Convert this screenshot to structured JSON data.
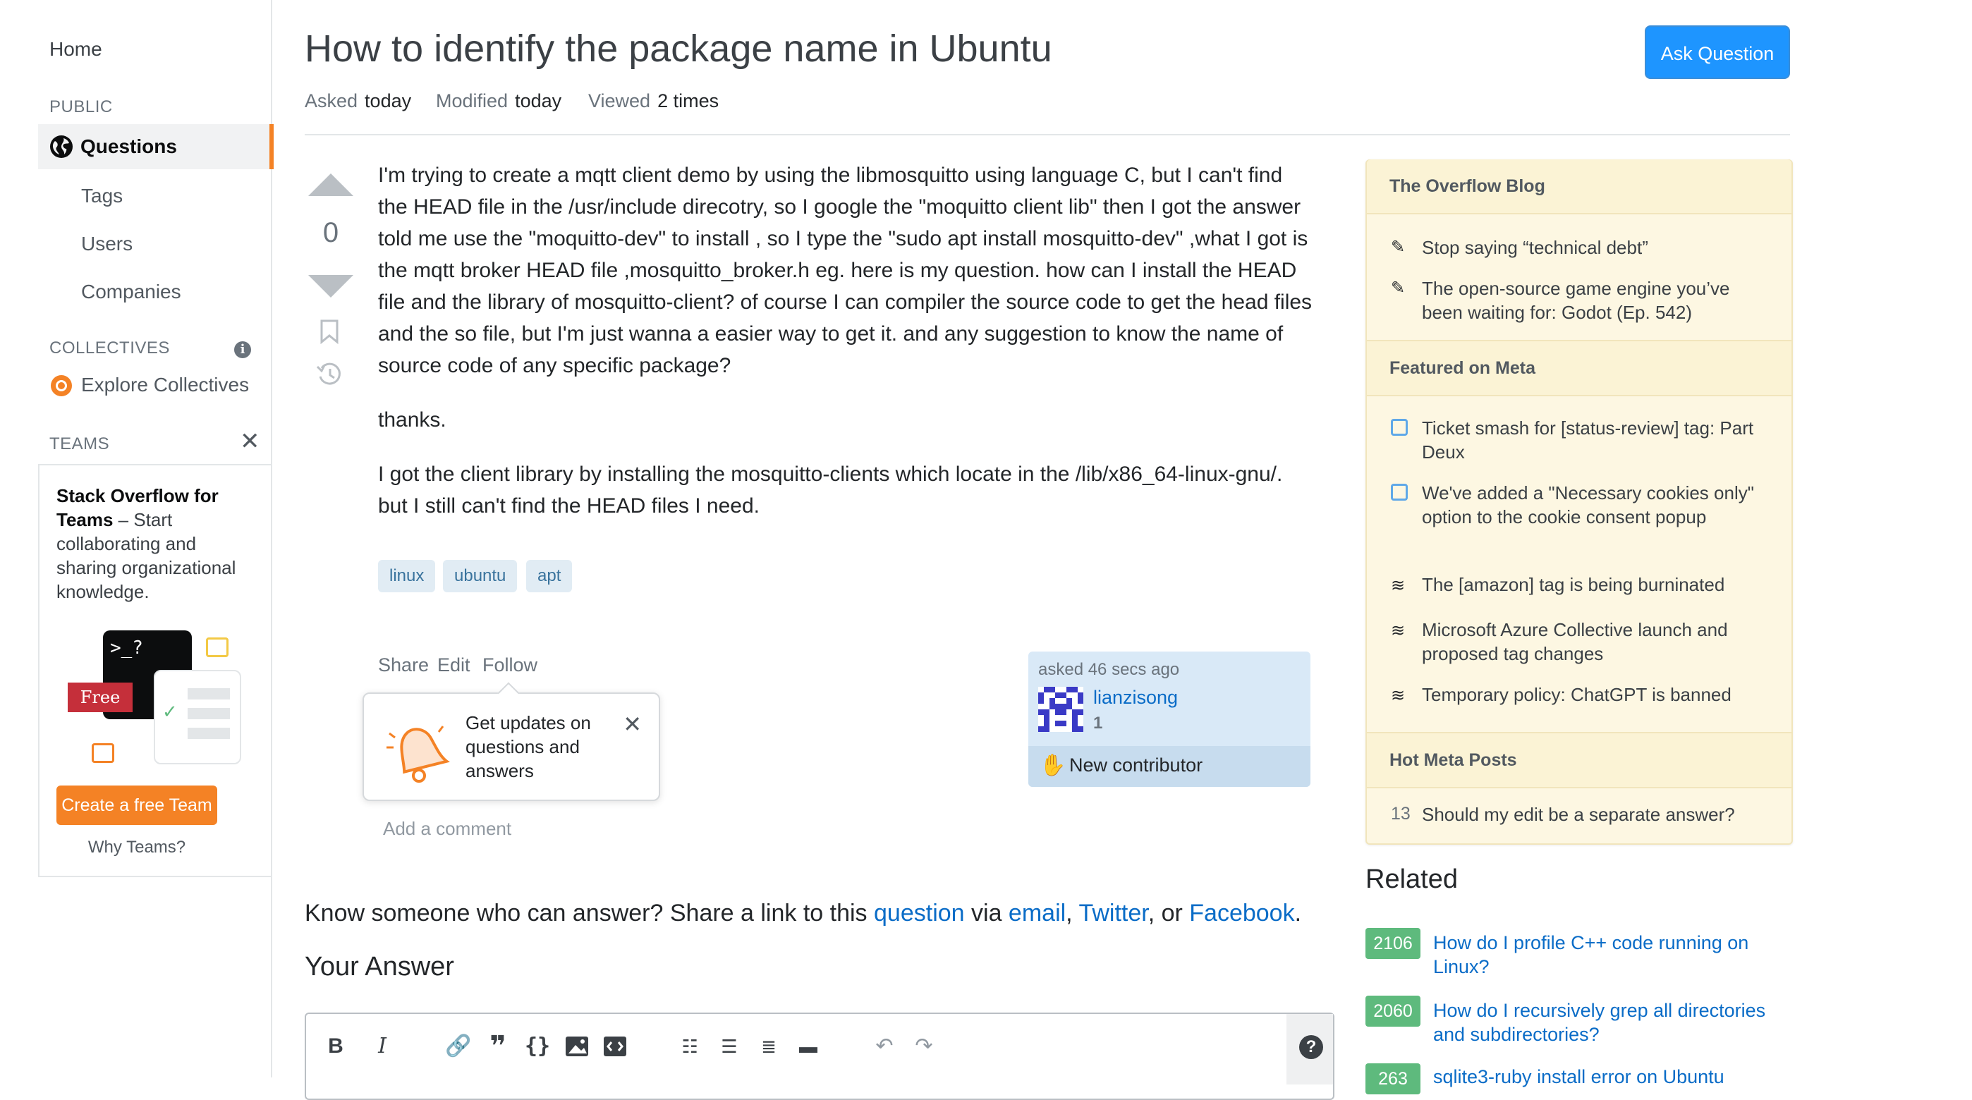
{
  "sidebar": {
    "home": "Home",
    "public_heading": "PUBLIC",
    "questions": "Questions",
    "tags": "Tags",
    "users": "Users",
    "companies": "Companies",
    "collectives_heading": "COLLECTIVES",
    "explore_collectives": "Explore Collectives",
    "teams_heading": "TEAMS",
    "teams_card": {
      "title_bold": "Stack Overflow for Teams",
      "title_rest": " – Start collaborating and sharing organizational knowledge.",
      "free_badge": "Free",
      "prompt_glyph": ">_?",
      "create_button": "Create a free Team",
      "why_link": "Why Teams?"
    }
  },
  "question": {
    "title": "How to identify the package name in Ubuntu",
    "ask_button": "Ask Question",
    "asked_label": "Asked",
    "asked_value": "today",
    "modified_label": "Modified",
    "modified_value": "today",
    "viewed_label": "Viewed",
    "viewed_value": "2 times",
    "vote_count": "0",
    "body": [
      "I'm trying to create a mqtt client demo by using the libmosquitto using language C, but I can't find the HEAD file in the /usr/include direcotry, so I google the \"moquitto client lib\" then I got the answer told me use the \"moquitto-dev\" to install , so I type the \"sudo apt install mosquitto-dev\" ,what I got is the mqtt broker HEAD file ,mosquitto_broker.h eg. here is my question. how can I install the HEAD file and the library of mosquitto-client? of course I can compiler the source code to get the head files and the so file, but I'm just wanna a easier way to get it. and any suggestion to know the name of source code of any specific package?",
      "thanks.",
      "I got the client library by installing the mosquitto-clients which locate in the /lib/x86_64-linux-gnu/. but I still can't find the HEAD files I need."
    ],
    "tags": [
      "linux",
      "ubuntu",
      "apt"
    ],
    "menu": {
      "share": "Share",
      "edit": "Edit",
      "follow": "Follow"
    },
    "popover_text": "Get updates on questions and answers",
    "add_comment": "Add a comment",
    "user_card": {
      "asked_time": "asked 46 secs ago",
      "username": "lianzisong",
      "reputation": "1",
      "new_contributor": "New contributor"
    }
  },
  "share_line": {
    "prefix": "Know someone who can answer? Share a link to this ",
    "question_link": "question",
    "via": " via ",
    "email": "email",
    "comma1": ", ",
    "twitter": "Twitter",
    "or": ", or ",
    "facebook": "Facebook",
    "end": "."
  },
  "your_answer": "Your Answer",
  "editor_toolbar": [
    "bold-icon",
    "italic-icon",
    "link-icon",
    "quote-icon",
    "code-icon",
    "image-icon",
    "snippet-icon",
    "ordered-list-icon",
    "unordered-list-icon",
    "heading-icon",
    "horizontal-rule-icon",
    "undo-icon",
    "redo-icon",
    "help-icon"
  ],
  "right_sidebar": {
    "blog_heading": "The Overflow Blog",
    "blog_items": [
      "Stop saying “technical debt”",
      "The open-source game engine you’ve been waiting for: Godot (Ep. 542)"
    ],
    "meta_heading": "Featured on Meta",
    "meta_items": [
      "Ticket smash for [status-review] tag: Part Deux",
      "We've added a \"Necessary cookies only\" option to the cookie consent popup",
      "The [amazon] tag is being burninated",
      "Microsoft Azure Collective launch and proposed tag changes",
      "Temporary policy: ChatGPT is banned"
    ],
    "hot_heading": "Hot Meta Posts",
    "hot_items": [
      {
        "count": "13",
        "title": "Should my edit be a separate answer?"
      }
    ],
    "related_heading": "Related",
    "related": [
      {
        "score": "2106",
        "title": "How do I profile C++ code running on Linux?"
      },
      {
        "score": "2060",
        "title": "How do I recursively grep all directories and subdirectories?"
      },
      {
        "score": "263",
        "title": "sqlite3-ruby install error on Ubuntu"
      }
    ]
  },
  "colors": {
    "accent": "#f48225",
    "brand_blue": "#1e95ff",
    "link": "#0a6cc7",
    "tag_bg": "#e1ecf4",
    "score_green": "#5eba7d",
    "blog_bg": "#fdf7e2"
  }
}
